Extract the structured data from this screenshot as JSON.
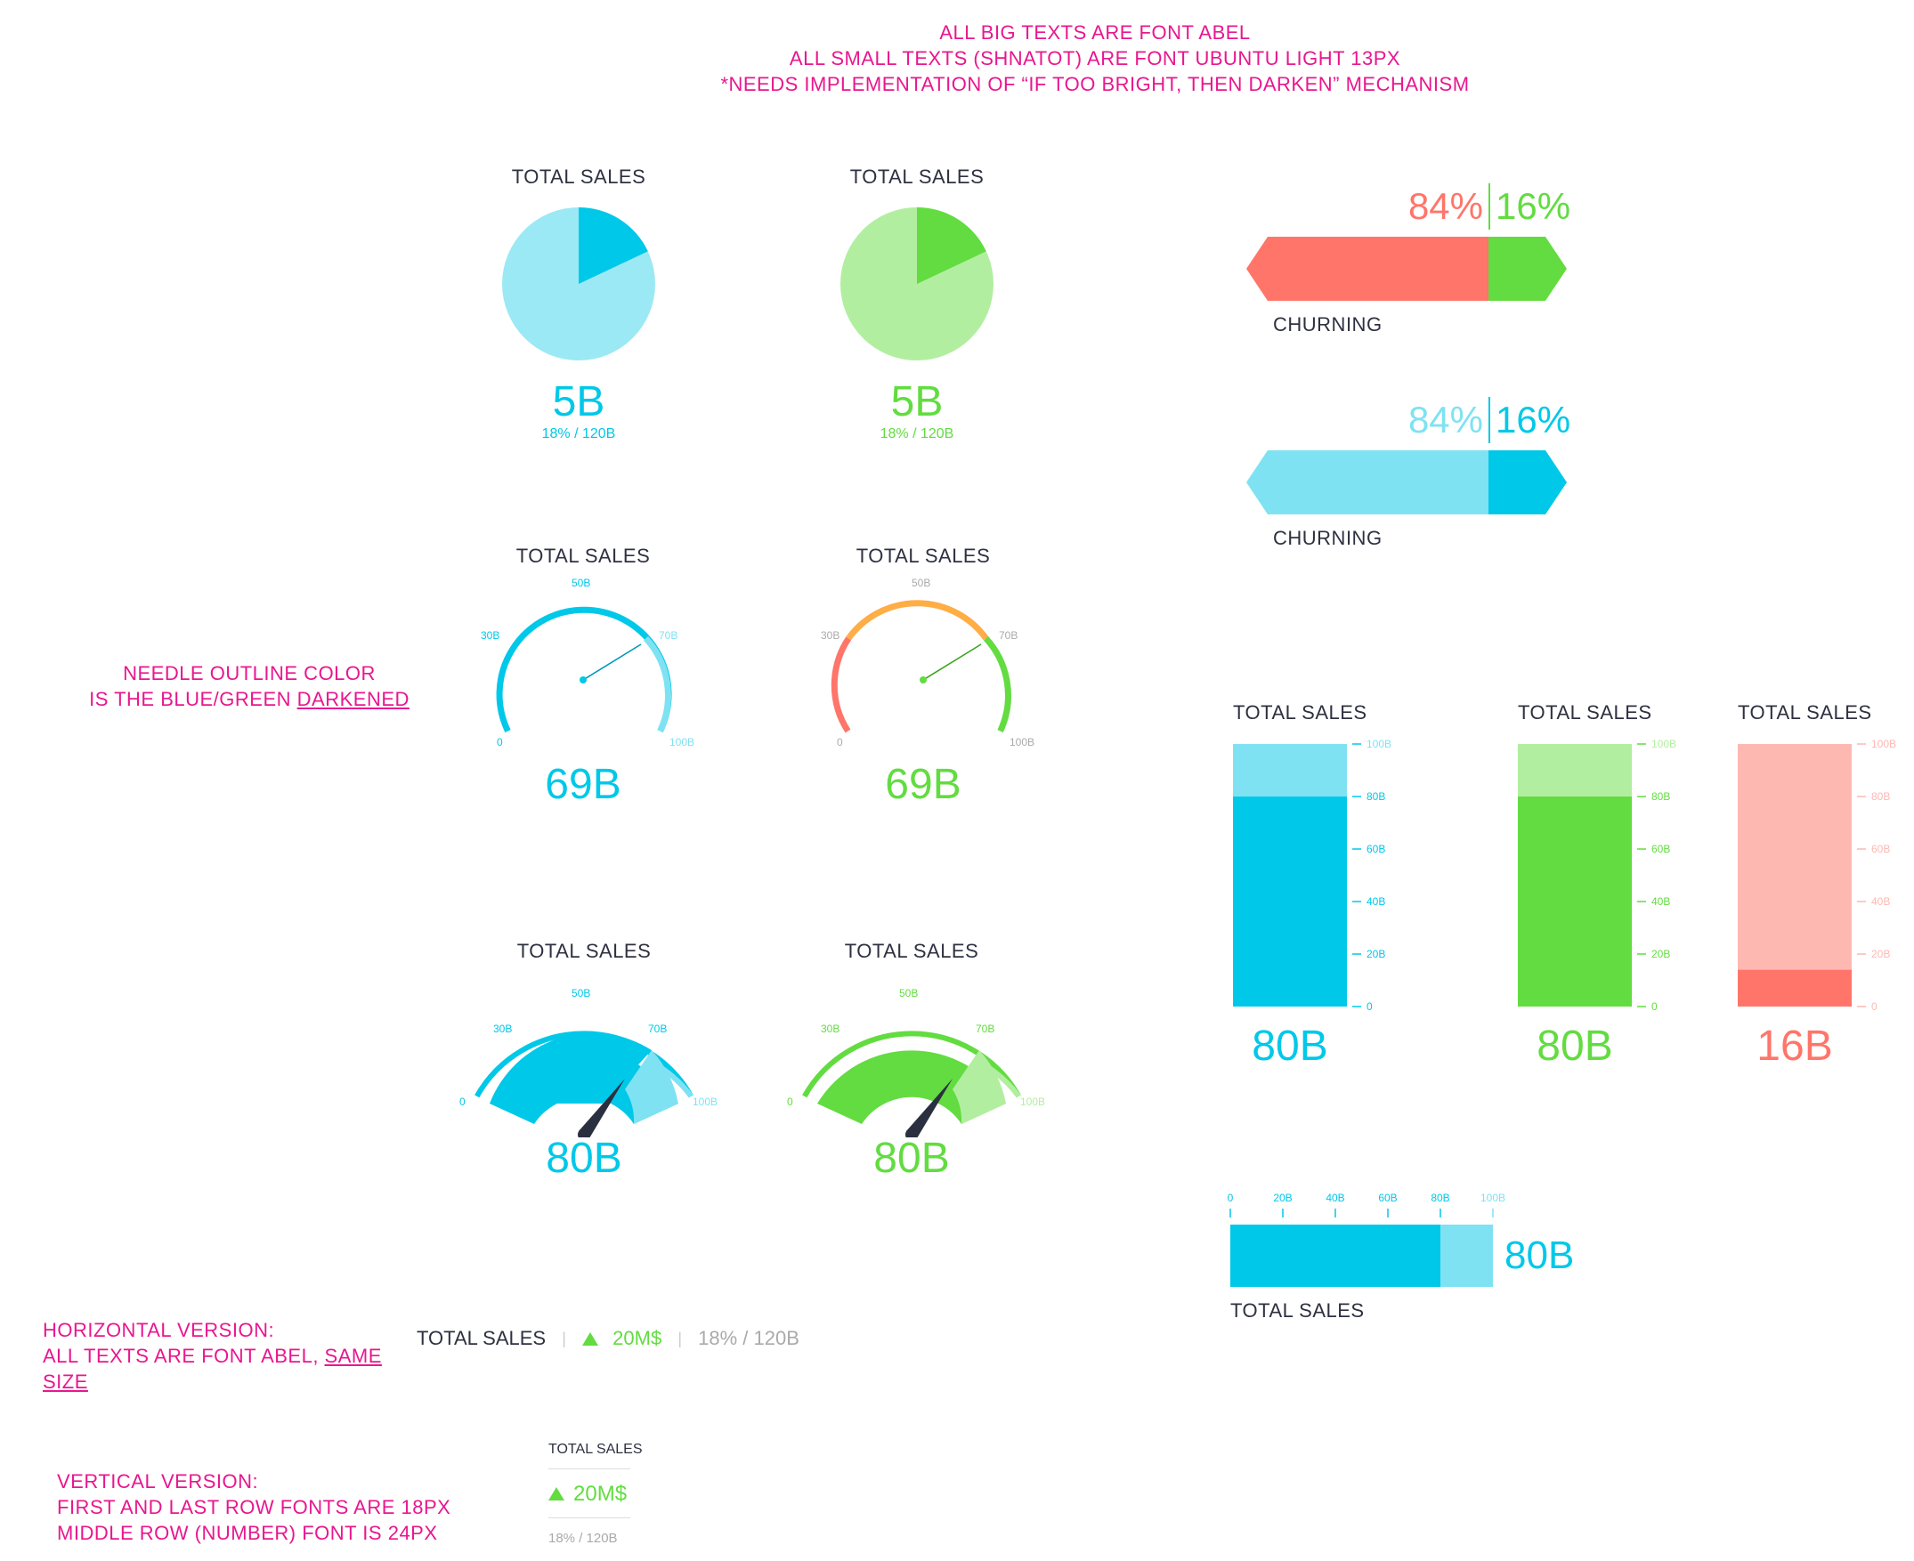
{
  "notes": {
    "top_line1": "ALL BIG TEXTS ARE FONT ABEL",
    "top_line2": "ALL SMALL TEXTS (SHNATOT) ARE FONT UBUNTU LIGHT 13PX",
    "top_line3": "*NEEDS IMPLEMENTATION OF “IF TOO BRIGHT, THEN DARKEN” MECHANISM",
    "needle_line1": "NEEDLE OUTLINE COLOR",
    "needle_line2_prefix": "IS THE BLUE/GREEN ",
    "needle_line2_underlined": "DARKENED",
    "horizontal_line1": "HORIZONTAL VERSION:",
    "horizontal_line2_prefix": "ALL TEXTS ARE FONT ABEL, ",
    "horizontal_line2_underlined": "SAME SIZE",
    "vertical_line1": "VERTICAL VERSION:",
    "vertical_line2": "FIRST AND LAST ROW FONTS ARE 18PX",
    "vertical_line3": "MIDDLE ROW (NUMBER) FONT IS 24PX"
  },
  "colors": {
    "blue": "#00c8e8",
    "light_blue": "#7fe2f2",
    "pale_blue": "#9be9f4",
    "green": "#62dc40",
    "light_green": "#b2eea0",
    "red": "#ff756a",
    "light_red": "#feb8b2",
    "orange": "#ffad45",
    "needle": "#2b3040",
    "note_pink": "#e8178f"
  },
  "pies": [
    {
      "title": "TOTAL SALES",
      "value": "5B",
      "subtext": "18% / 120B",
      "fraction": 0.18,
      "color": "blue"
    },
    {
      "title": "TOTAL SALES",
      "value": "5B",
      "subtext": "18% / 120B",
      "fraction": 0.18,
      "color": "green"
    }
  ],
  "arc_gauges": [
    {
      "title": "TOTAL SALES",
      "value": "69B",
      "ticks": [
        "0",
        "30B",
        "50B",
        "70B",
        "100B"
      ],
      "needle_fraction": 0.69,
      "color": "blue"
    },
    {
      "title": "TOTAL SALES",
      "value": "69B",
      "ticks": [
        "0",
        "30B",
        "50B",
        "70B",
        "100B"
      ],
      "needle_fraction": 0.69,
      "color": "multi"
    }
  ],
  "speedometers": [
    {
      "title": "TOTAL SALES",
      "value": "80B",
      "ticks": [
        "0",
        "30B",
        "50B",
        "70B",
        "100B"
      ],
      "fill_fraction": 0.8,
      "color": "blue"
    },
    {
      "title": "TOTAL SALES",
      "value": "80B",
      "ticks": [
        "0",
        "30B",
        "50B",
        "70B",
        "100B"
      ],
      "fill_fraction": 0.8,
      "color": "green"
    }
  ],
  "churning": [
    {
      "left_pct": "84%",
      "right_pct": "16%",
      "label": "CHURNING",
      "left_fraction": 0.84,
      "scheme": "red-green"
    },
    {
      "left_pct": "84%",
      "right_pct": "16%",
      "label": "CHURNING",
      "left_fraction": 0.84,
      "scheme": "blue"
    }
  ],
  "vertical_bars": [
    {
      "title": "TOTAL SALES",
      "value": "80B",
      "fill_fraction": 0.8,
      "color": "blue",
      "ticks": [
        "100B",
        "80B",
        "60B",
        "40B",
        "20B",
        "0"
      ]
    },
    {
      "title": "TOTAL SALES",
      "value": "80B",
      "fill_fraction": 0.8,
      "color": "green",
      "ticks": [
        "100B",
        "80B",
        "60B",
        "40B",
        "20B",
        "0"
      ]
    },
    {
      "title": "TOTAL SALES",
      "value": "16B",
      "fill_fraction": 0.14,
      "color": "red",
      "ticks": [
        "100B",
        "80B",
        "60B",
        "40B",
        "20B",
        "0"
      ]
    }
  ],
  "horizontal_bar": {
    "ticks": [
      "0",
      "20B",
      "40B",
      "60B",
      "80B",
      "100B"
    ],
    "value": "80B",
    "label": "TOTAL SALES",
    "fill_fraction": 0.8
  },
  "horizontal_version": {
    "title": "TOTAL SALES",
    "value": "20M$",
    "sub": "18% / 120B"
  },
  "vertical_version": {
    "title": "TOTAL SALES",
    "value": "20M$",
    "sub": "18% / 120B"
  }
}
